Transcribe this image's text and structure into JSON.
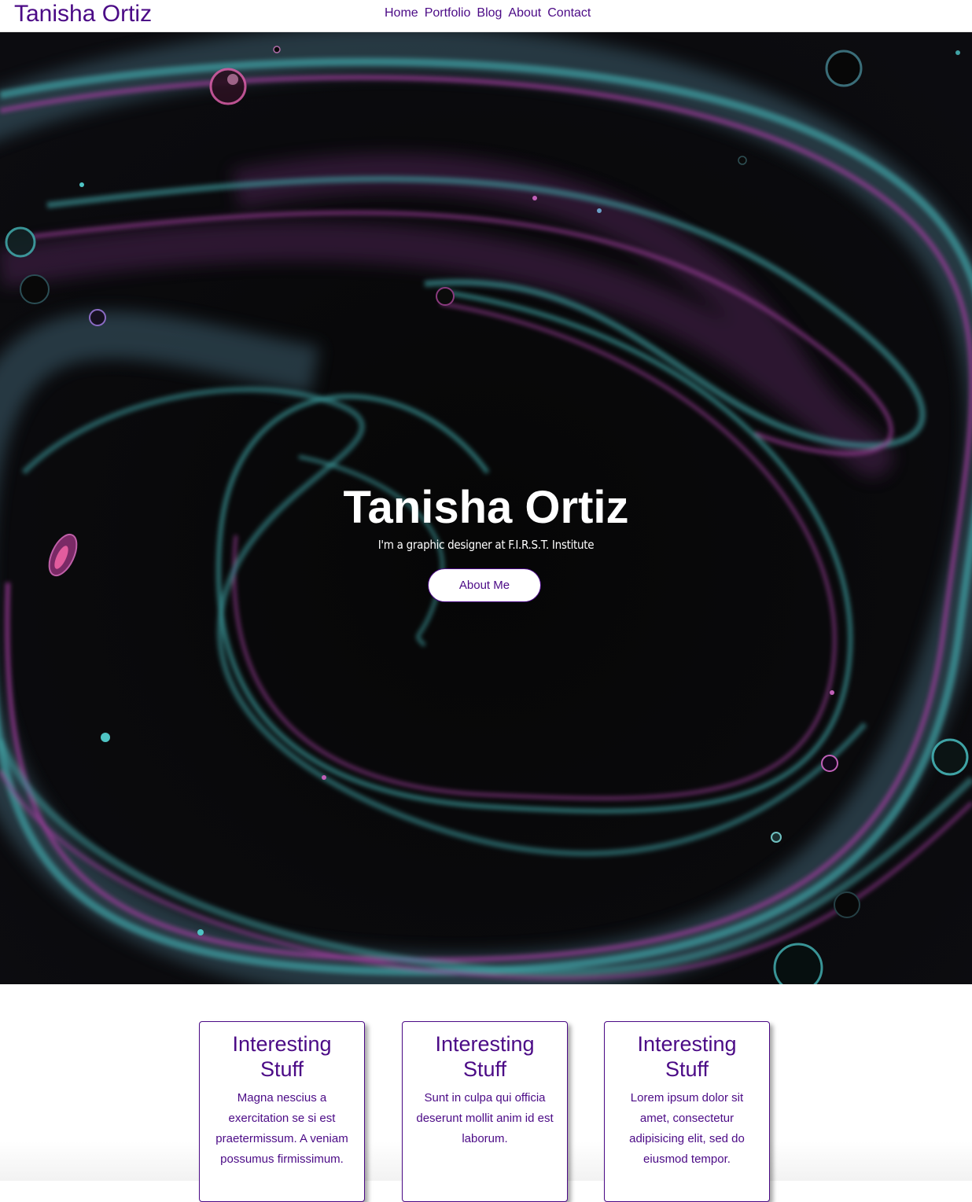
{
  "header": {
    "brand": "Tanisha Ortiz",
    "nav": [
      "Home",
      "Portfolio",
      "Blog",
      "About",
      "Contact"
    ]
  },
  "hero": {
    "title": "Tanisha Ortiz",
    "subtitle": "I'm a graphic designer at F.I.R.S.T. Institute",
    "button_label": "About Me"
  },
  "cards": [
    {
      "title": "Interesting Stuff",
      "text": "Magna nescius a exercitation se si est praetermissum. A veniam possumus firmissimum."
    },
    {
      "title": "Interesting Stuff",
      "text": "Sunt in culpa qui officia deserunt mollit anim id est laborum."
    },
    {
      "title": "Interesting Stuff",
      "text": "Lorem ipsum dolor sit amet, consectetur adipisicing elit, sed do eiusmod tempor."
    }
  ],
  "colors": {
    "accent": "#4b0a86",
    "hero_background": "#050505",
    "swirl_teal": "#3fa3a5",
    "swirl_magenta": "#a03e9e"
  }
}
